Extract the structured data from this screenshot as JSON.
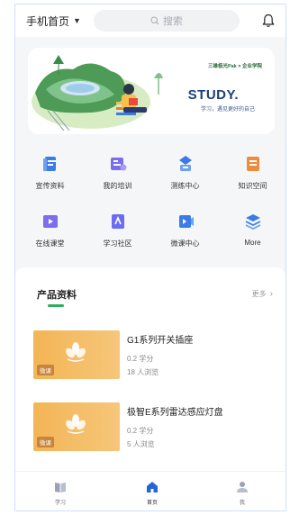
{
  "header": {
    "home_label": "手机首页",
    "search_placeholder": "搜索"
  },
  "banner": {
    "brand": "三雄极光Pak × 企业学院",
    "headline": "STUDY.",
    "subline": "学习，遇见更好的自己"
  },
  "menu": [
    {
      "label": "宣传资料",
      "icon": "brochure-icon",
      "color": "#3b7be8"
    },
    {
      "label": "我的培训",
      "icon": "training-icon",
      "color": "#7b6cf0"
    },
    {
      "label": "测练中心",
      "icon": "practice-icon",
      "color": "#3b7be8"
    },
    {
      "label": "知识空间",
      "icon": "knowledge-icon",
      "color": "#f08a3c"
    },
    {
      "label": "在线课堂",
      "icon": "video-class-icon",
      "color": "#7b6cf0"
    },
    {
      "label": "学习社区",
      "icon": "community-icon",
      "color": "#6b6cf0"
    },
    {
      "label": "微课中心",
      "icon": "micro-course-icon",
      "color": "#3b7be8"
    },
    {
      "label": "More",
      "icon": "layers-icon",
      "color": "#3b7be8"
    }
  ],
  "products": {
    "title": "产品资料",
    "more": "更多",
    "accent": "#2dae5c",
    "items": [
      {
        "title": "G1系列开关插座",
        "credit": "0.2 学分",
        "views": "18 人浏览",
        "tag": "微课"
      },
      {
        "title": "极智E系列雷达感应灯盘",
        "credit": "0.2 学分",
        "views": "5 人浏览",
        "tag": "微课"
      }
    ]
  },
  "tabbar": {
    "tabs": [
      {
        "label": "学习",
        "icon": "book-icon"
      },
      {
        "label": "首页",
        "icon": "home-icon"
      },
      {
        "label": "我",
        "icon": "user-icon"
      }
    ]
  }
}
